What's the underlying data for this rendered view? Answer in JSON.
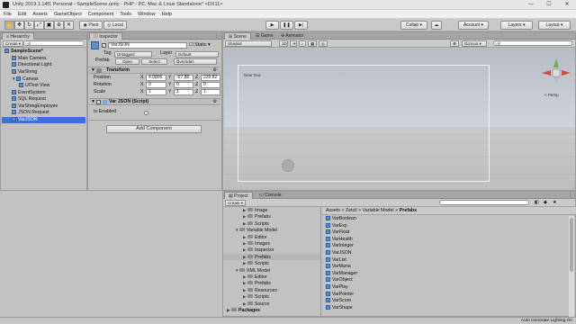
{
  "window": {
    "title": "Unity 2019.1.14f1 Personal - SampleScene.unity - PHP - PC, Mac & Linux Standalone* <DX11>",
    "controls": [
      "—",
      "☐",
      "✕"
    ]
  },
  "menu": [
    "File",
    "Edit",
    "Assets",
    "GameObject",
    "Component",
    "Tools",
    "Window",
    "Help"
  ],
  "toolbar": {
    "pivot_label": "Pivot",
    "local_label": "Local",
    "collab_label": "Collab ▾",
    "account_label": "Account ▾",
    "layers_label": "Layers ▾",
    "layout_label": "Layout ▾"
  },
  "hierarchy": {
    "tab": "Hierarchy",
    "create_label": "Create ▾",
    "search_prefix": "All",
    "items": [
      {
        "label": "SampleScene*",
        "depth": 0,
        "icon": "unity-icon",
        "bold": true
      },
      {
        "label": "Main Camera",
        "depth": 1,
        "icon": "cube-icon"
      },
      {
        "label": "Directional Light",
        "depth": 1,
        "icon": "cube-icon"
      },
      {
        "label": "VarString",
        "depth": 1,
        "icon": "cube-icon"
      },
      {
        "label": "Canvas",
        "depth": 1,
        "icon": "cube-icon",
        "expanded": true
      },
      {
        "label": "UIText View",
        "depth": 2,
        "icon": "cube-icon"
      },
      {
        "label": "EventSystem",
        "depth": 1,
        "icon": "cube-icon"
      },
      {
        "label": "SQL Request",
        "depth": 1,
        "icon": "cube-icon"
      },
      {
        "label": "VarStringEmployee",
        "depth": 1,
        "icon": "cube-icon"
      },
      {
        "label": "JSON Request",
        "depth": 1,
        "icon": "cube-icon"
      },
      {
        "label": "VarJSON",
        "depth": 1,
        "icon": "cube-icon",
        "selected": true
      }
    ]
  },
  "inspector": {
    "tab": "Inspector",
    "object_name": "VarJSON",
    "static_label": "Static ▾",
    "tag_label": "Tag",
    "tag_value": "Untagged",
    "layer_label": "Layer",
    "layer_value": "Default",
    "prefab_label": "Prefab",
    "open_label": "Open",
    "select_label": "Select",
    "overrides_label": "Overrides",
    "transform_title": "Transform",
    "position_label": "Position",
    "rotation_label": "Rotation",
    "scale_label": "Scale",
    "position": {
      "x": "4.0806",
      "y": "-67.88",
      "z": "235.82"
    },
    "rotation": {
      "x": "0",
      "y": "0",
      "z": "0"
    },
    "scale": {
      "x": "1",
      "y": "1",
      "z": "1"
    },
    "script_title": "Var JSON (Script)",
    "is_enabled_label": "Is Enabled",
    "add_component_label": "Add Component"
  },
  "scene": {
    "tabs": [
      "Scene",
      "Game",
      "Animator"
    ],
    "shading": "Shaded",
    "mode_2d": "2D",
    "gizmos_label": "Gizmos ▾",
    "search_prefix": "All",
    "canvas_text": "New Text",
    "persp_label": "< Persp"
  },
  "project": {
    "tabs": [
      "Project",
      "Console"
    ],
    "create_label": "Create ▾",
    "breadcrumb": [
      "Assets",
      "Zetcil",
      "Variable Model",
      "Prefabs"
    ],
    "tree": [
      {
        "label": "Image",
        "depth": 2
      },
      {
        "label": "Prefabs",
        "depth": 2
      },
      {
        "label": "Scripts",
        "depth": 2
      },
      {
        "label": "Variable Model",
        "depth": 1,
        "expanded": true
      },
      {
        "label": "Editor",
        "depth": 2
      },
      {
        "label": "Images",
        "depth": 2
      },
      {
        "label": "Inspector",
        "depth": 2
      },
      {
        "label": "Prefabs",
        "depth": 2,
        "selected": true
      },
      {
        "label": "Scripts",
        "depth": 2
      },
      {
        "label": "XML Model",
        "depth": 1,
        "expanded": true
      },
      {
        "label": "Editor",
        "depth": 2
      },
      {
        "label": "Prefabs",
        "depth": 2
      },
      {
        "label": "Resources",
        "depth": 2
      },
      {
        "label": "Scripts",
        "depth": 2
      },
      {
        "label": "Source",
        "depth": 2
      },
      {
        "label": "Packages",
        "depth": 0,
        "bold": true
      }
    ],
    "assets": [
      "VarBoolean",
      "VarExp",
      "VarFloat",
      "VarHealth",
      "VarInteger",
      "VarJSON",
      "VarList",
      "VarMana",
      "VarManager",
      "VarObject",
      "VarPlay",
      "VarPointer",
      "VarScore",
      "VarShape"
    ]
  },
  "status_bar": {
    "text": "Auto Generate Lighting On"
  },
  "colors": {
    "selection": "#3a72da",
    "panel_bg": "#c2c2c2",
    "scene_sky": "#cfd3dc"
  }
}
